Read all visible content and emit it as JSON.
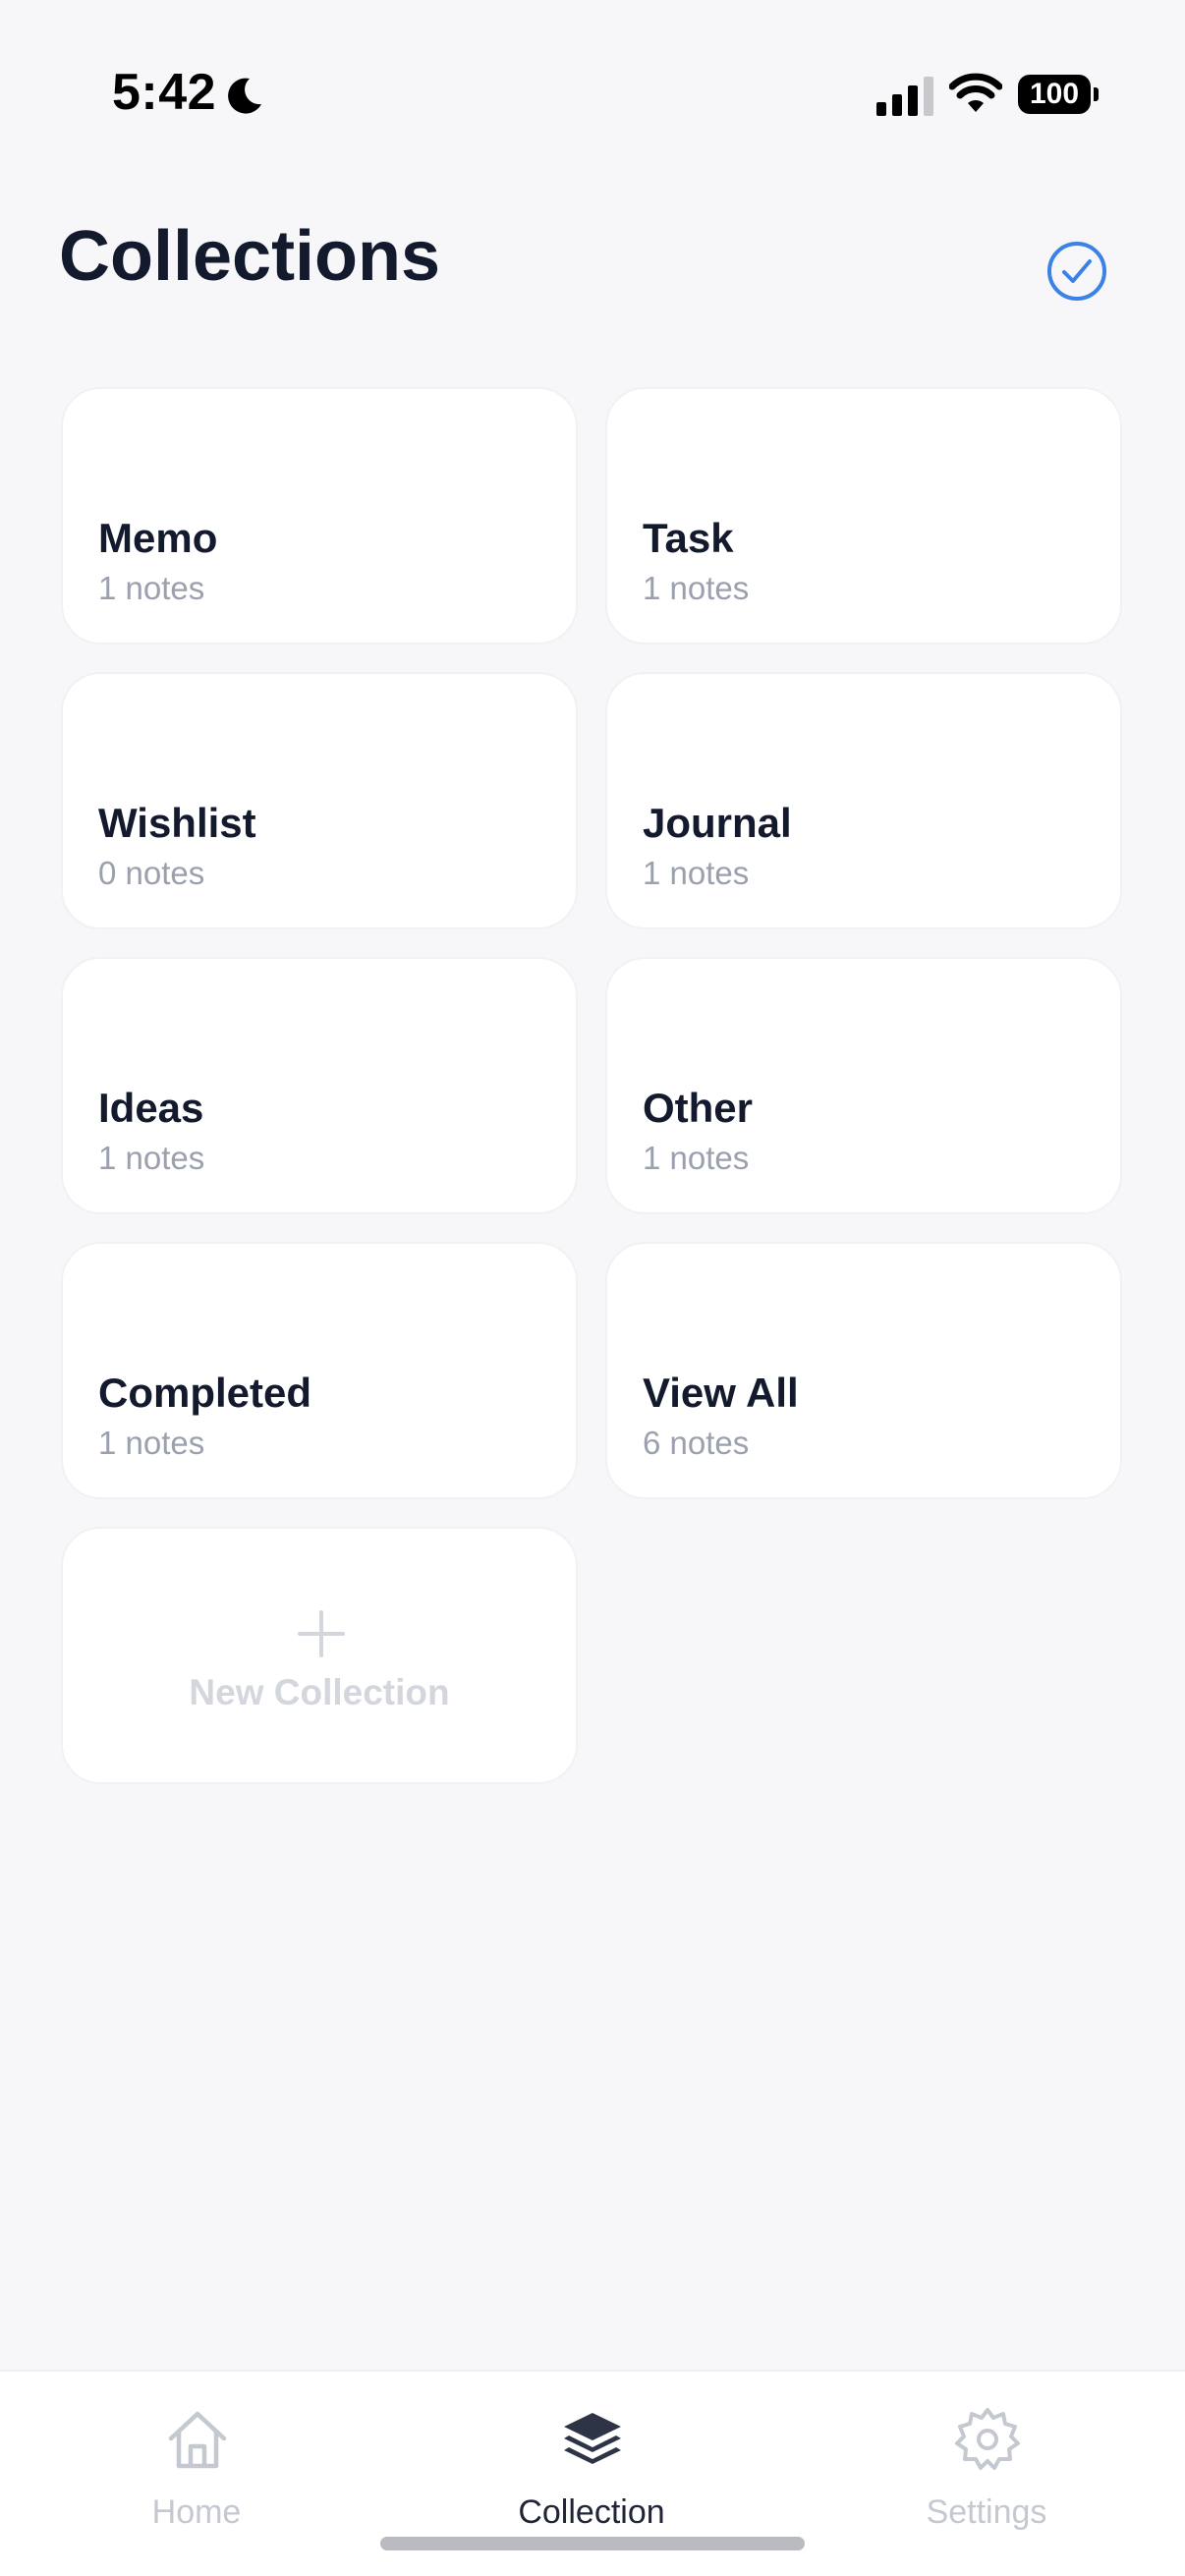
{
  "status_bar": {
    "time": "5:42",
    "battery": "100"
  },
  "header": {
    "title": "Collections"
  },
  "collections": [
    {
      "name": "Memo",
      "count": "1 notes"
    },
    {
      "name": "Task",
      "count": "1 notes"
    },
    {
      "name": "Wishlist",
      "count": "0 notes"
    },
    {
      "name": "Journal",
      "count": "1 notes"
    },
    {
      "name": "Ideas",
      "count": "1 notes"
    },
    {
      "name": "Other",
      "count": "1 notes"
    },
    {
      "name": "Completed",
      "count": "1 notes"
    },
    {
      "name": "View All",
      "count": "6 notes"
    }
  ],
  "new_collection": {
    "label": "New Collection"
  },
  "tabs": [
    {
      "label": "Home",
      "icon": "home-icon",
      "active": false
    },
    {
      "label": "Collection",
      "icon": "layers-icon",
      "active": true
    },
    {
      "label": "Settings",
      "icon": "gear-icon",
      "active": false
    }
  ],
  "colors": {
    "accent": "#3b82e6",
    "background": "#f7f7f9",
    "card": "#ffffff",
    "title": "#141a2e",
    "muted": "#9aa0ad",
    "inactive_tab": "#c4c8d0"
  }
}
